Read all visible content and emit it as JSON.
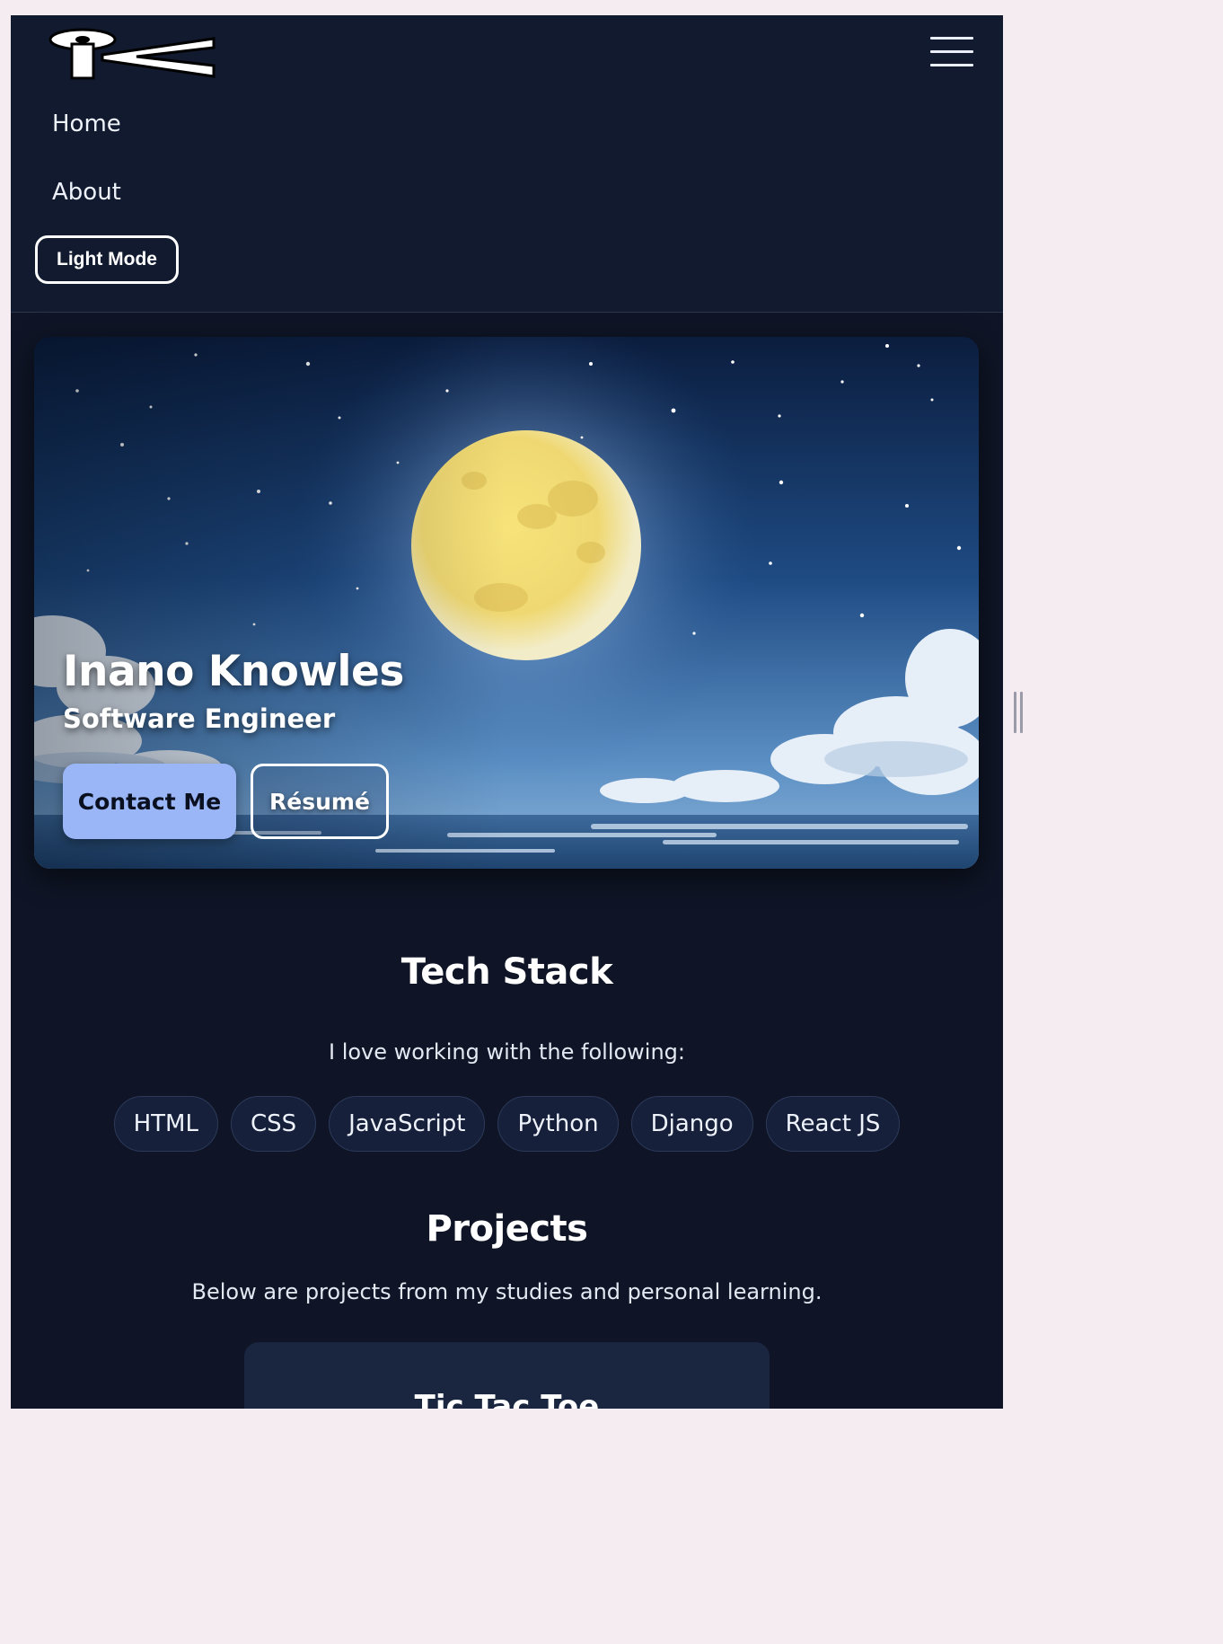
{
  "nav": {
    "logo_alt": "IK logo",
    "menu_icon": "hamburger-menu-icon",
    "links": [
      {
        "label": "Home"
      },
      {
        "label": "About"
      }
    ],
    "mode_toggle_label": "Light Mode"
  },
  "hero": {
    "name": "Inano Knowles",
    "title": "Software Engineer",
    "contact_label": "Contact Me",
    "resume_label": "Résumé",
    "background": "moonlit-sky-over-sea-illustration"
  },
  "tech_stack": {
    "heading": "Tech Stack",
    "subheading": "I love working with the following:",
    "items": [
      "HTML",
      "CSS",
      "JavaScript",
      "Python",
      "Django",
      "React JS"
    ]
  },
  "projects": {
    "heading": "Projects",
    "subheading": "Below are projects from my studies and personal learning.",
    "first_card_title": "Tic Tac Toe"
  },
  "colors": {
    "page_background": "#0f1526",
    "nav_background": "#111a2e",
    "accent_button": "#9ab6f6",
    "chip_background": "#16203a",
    "outer_background": "#f4ecf1"
  }
}
